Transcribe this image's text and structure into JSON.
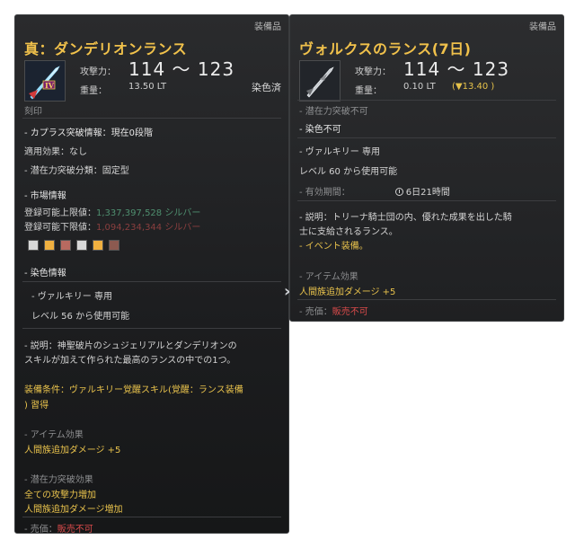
{
  "left": {
    "category": "装備品",
    "name": "真：ダンデリオンランス",
    "icon": "lance-icon",
    "atk_label": "攻撃力：",
    "atk_value": "114 ～ 123",
    "weight_label": "重量：",
    "weight_value": "13.50 LT",
    "dye_status": "染色済",
    "engraving": "刻印",
    "caphras": "- カプラス突破情報：現在0段階",
    "applied": "適用効果：なし",
    "potential": "- 潜在力突破分類：固定型",
    "market_title": "- 市場情報",
    "upper_label": "登録可能上限値：",
    "upper_value": "1,337,397,528 シルバー",
    "lower_label": "登録可能下限値：",
    "lower_value": "1,094,234,344 シルバー",
    "swatch_colors": [
      "#d8d8d8",
      "#f0b040",
      "#b86a60",
      "#d8d8d8",
      "#f0b040",
      "#8c5a50"
    ],
    "dye_info": "- 染色情報",
    "valkyrie": "- ヴァルキリー 専用",
    "level": "レベル 56 から使用可能",
    "desc1": "- 説明：神聖破片のシュジェリアルとダンデリオンの",
    "desc2": "スキルが加えて作られた最高のランスの中での1つ。",
    "equip1": "装備条件：ヴァルキリー覚醒スキル(覚醒：ランス装備",
    "equip2": ") 習得",
    "effect_title": "- アイテム効果",
    "effect1": "人間族追加ダメージ +5",
    "pot_title": "- 潜在力突破効果",
    "pot1": "全ての攻撃力増加",
    "pot2": "人間族追加ダメージ増加",
    "sell_label": "- 売価：",
    "sell_value": "販売不可"
  },
  "right": {
    "category": "装備品",
    "name": "ヴォルクスのランス(7日)",
    "icon": "lance-icon",
    "atk_label": "攻撃力：",
    "atk_value": "114 ～ 123",
    "weight_label": "重量：",
    "weight_value": "0.10 LT",
    "weight_diff": "(▼13.40 )",
    "no_potential": "- 潜在力突破不可",
    "no_dye": "- 染色不可",
    "valkyrie": "- ヴァルキリー 専用",
    "level": "レベル 60 から使用可能",
    "validity_label": "- 有効期間：",
    "validity_value": "6日21時間",
    "desc1": "- 説明：トリーナ騎士団の内、優れた成果を出した騎",
    "desc2": "士に支給されるランス。",
    "event": "- イベント装備。",
    "effect_title": "- アイテム効果",
    "effect1": "人間族追加ダメージ +5",
    "sell_label": "- 売価：",
    "sell_value": "販売不可"
  }
}
